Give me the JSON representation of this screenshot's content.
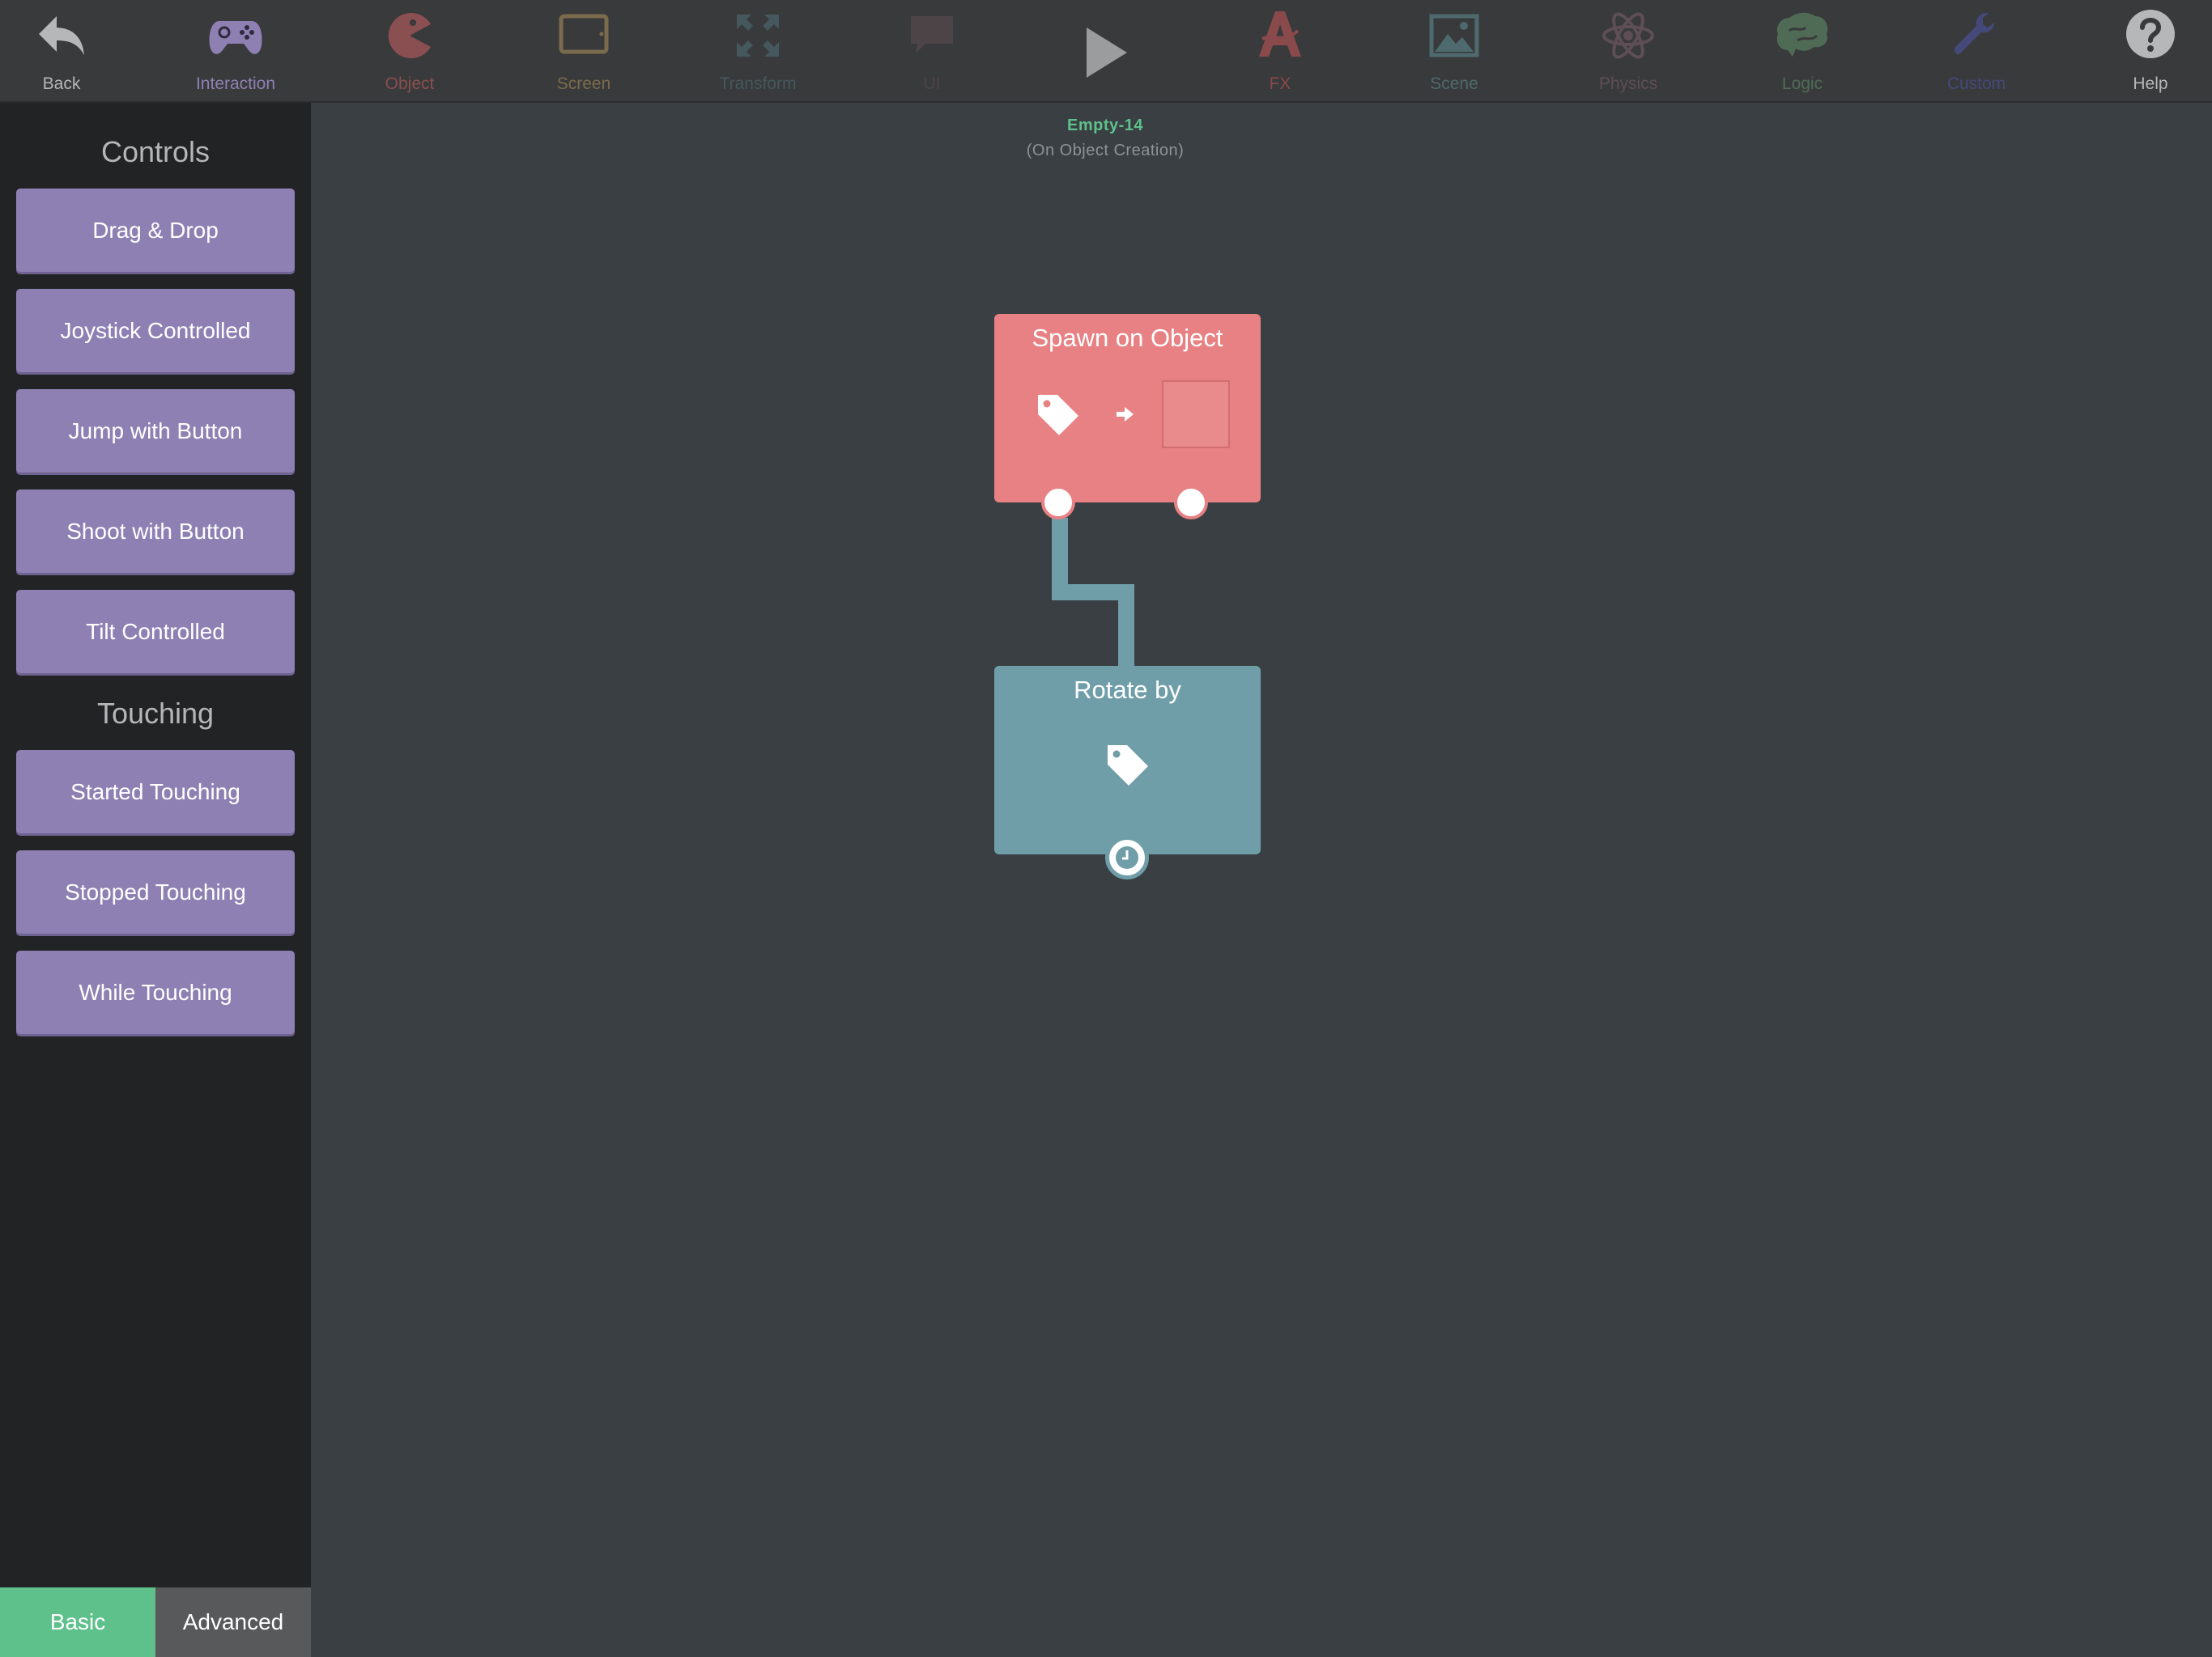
{
  "toolbar": {
    "items": [
      {
        "label": "Back",
        "icon": "back-arrow-icon",
        "color": "#b5b7b9"
      },
      {
        "label": "Interaction",
        "icon": "gamepad-icon",
        "color": "#8f80b3"
      },
      {
        "label": "Object",
        "icon": "pacman-icon",
        "color": "#8a4f51"
      },
      {
        "label": "Screen",
        "icon": "tablet-icon",
        "color": "#7b6b4d"
      },
      {
        "label": "Transform",
        "icon": "expand-arrows-icon",
        "color": "#44585d"
      },
      {
        "label": "UI",
        "icon": "speech-bubble-icon",
        "color": "#4d4448"
      },
      {
        "label": "FX",
        "icon": "fx-letter-icon",
        "color": "#8a4a4c"
      },
      {
        "label": "Scene",
        "icon": "landscape-image-icon",
        "color": "#4e6a6e"
      },
      {
        "label": "Physics",
        "icon": "atom-icon",
        "color": "#5e4e55"
      },
      {
        "label": "Logic",
        "icon": "brain-icon",
        "color": "#4f6b56"
      },
      {
        "label": "Custom",
        "icon": "wrench-icon",
        "color": "#45497a"
      },
      {
        "label": "Help",
        "icon": "question-circle-icon",
        "color": "#b5b7b9"
      }
    ],
    "play_icon": "play-icon"
  },
  "sidebar": {
    "controls_heading": "Controls",
    "controls": [
      "Drag & Drop",
      "Joystick Controlled",
      "Jump with Button",
      "Shoot with Button",
      "Tilt Controlled"
    ],
    "touching_heading": "Touching",
    "touching": [
      "Started Touching",
      "Stopped Touching",
      "While Touching"
    ],
    "modes": {
      "basic": "Basic",
      "advanced": "Advanced"
    },
    "active_mode": "Basic"
  },
  "canvas": {
    "object_name": "Empty-14",
    "trigger": "(On Object Creation)",
    "blocks": {
      "spawn": {
        "title": "Spawn on Object",
        "color": "#e88183"
      },
      "rotate": {
        "title": "Rotate by",
        "color": "#6f9ea9"
      }
    }
  },
  "colors": {
    "accent_green": "#5ec08a",
    "behavior_purple": "#8f80b3"
  }
}
